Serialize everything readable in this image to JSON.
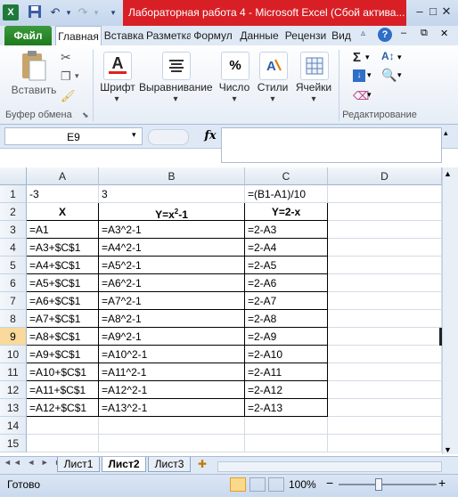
{
  "window": {
    "title": "Лабораторная работа 4  -  Microsoft Excel (Сбой актива...",
    "minimize": "–",
    "maximize": "□",
    "close": "✕"
  },
  "tabs": [
    "Файл",
    "Главная",
    "Вставка",
    "Разметка",
    "Формул",
    "Данные",
    "Рецензи",
    "Вид"
  ],
  "ribbon": {
    "paste": "Вставить",
    "clipboard_group": "Буфер обмена",
    "font": "Шрифт",
    "alignment": "Выравнивание",
    "number": "Число",
    "styles": "Стили",
    "cells": "Ячейки",
    "editing_group": "Редактирование",
    "percent_glyph": "%",
    "sigma_glyph": "Σ"
  },
  "formula_bar": {
    "name_box": "E9",
    "fx": "fx",
    "value": ""
  },
  "columns": [
    "A",
    "B",
    "C",
    "D"
  ],
  "rows": [
    {
      "n": "1",
      "a": "-3",
      "b": "3",
      "c": "=(B1-A1)/10"
    },
    {
      "n": "2",
      "a": "X",
      "b": "Y=x",
      "b_sup": "2",
      "b_tail": "-1",
      "c": "Y=2-x"
    },
    {
      "n": "3",
      "a": "=A1",
      "b": "=A3^2-1",
      "c": "=2-A3"
    },
    {
      "n": "4",
      "a": "=A3+$C$1",
      "b": "=A4^2-1",
      "c": "=2-A4"
    },
    {
      "n": "5",
      "a": "=A4+$C$1",
      "b": "=A5^2-1",
      "c": "=2-A5"
    },
    {
      "n": "6",
      "a": "=A5+$C$1",
      "b": "=A6^2-1",
      "c": "=2-A6"
    },
    {
      "n": "7",
      "a": "=A6+$C$1",
      "b": "=A7^2-1",
      "c": "=2-A7"
    },
    {
      "n": "8",
      "a": "=A7+$C$1",
      "b": "=A8^2-1",
      "c": "=2-A8"
    },
    {
      "n": "9",
      "a": "=A8+$C$1",
      "b": "=A9^2-1",
      "c": "=2-A9"
    },
    {
      "n": "10",
      "a": "=A9+$C$1",
      "b": "=A10^2-1",
      "c": "=2-A10"
    },
    {
      "n": "11",
      "a": "=A10+$C$1",
      "b": "=A11^2-1",
      "c": "=2-A11"
    },
    {
      "n": "12",
      "a": "=A11+$C$1",
      "b": "=A12^2-1",
      "c": "=2-A12"
    },
    {
      "n": "13",
      "a": "=A12+$C$1",
      "b": "=A13^2-1",
      "c": "=2-A13"
    },
    {
      "n": "14",
      "a": "",
      "b": "",
      "c": ""
    },
    {
      "n": "15",
      "a": "",
      "b": "",
      "c": ""
    }
  ],
  "selected_row": "9",
  "sheets": [
    "Лист1",
    "Лист2",
    "Лист3"
  ],
  "active_sheet": "Лист2",
  "status": {
    "ready": "Готово",
    "zoom": "100%",
    "zoom_out": "−",
    "zoom_in": "+"
  },
  "colors": {
    "title_red": "#d81f26",
    "file_tab": "#2a8a2a",
    "selection": "#f9d99b"
  }
}
